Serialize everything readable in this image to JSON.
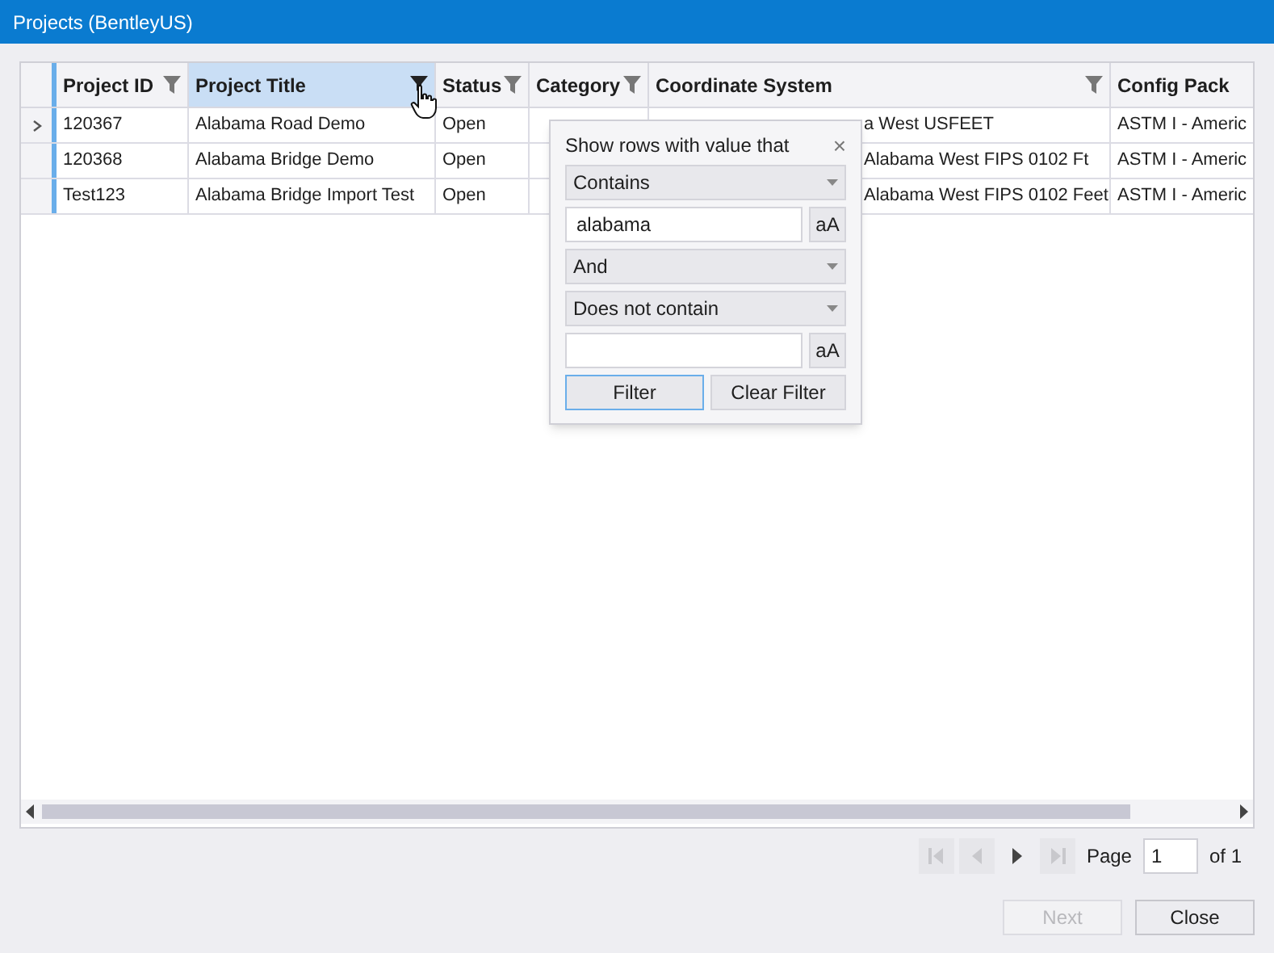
{
  "window": {
    "title": "Projects (BentleyUS)"
  },
  "table": {
    "columns": [
      {
        "label": "Project ID",
        "filterable": true,
        "selected": false
      },
      {
        "label": "Project Title",
        "filterable": true,
        "selected": true
      },
      {
        "label": "Status",
        "filterable": true,
        "selected": false
      },
      {
        "label": "Category",
        "filterable": true,
        "selected": false
      },
      {
        "label": "Coordinate System",
        "filterable": true,
        "selected": false
      },
      {
        "label": "Config Pack",
        "filterable": false,
        "selected": false
      }
    ],
    "rows": [
      {
        "current": true,
        "cells": [
          "120367",
          "Alabama Road Demo",
          "Open",
          "",
          "a West USFEET",
          "ASTM I - Americ"
        ]
      },
      {
        "current": false,
        "cells": [
          "120368",
          "Alabama Bridge Demo",
          "Open",
          "",
          "Alabama West FIPS 0102 Ft",
          "ASTM I - Americ"
        ]
      },
      {
        "current": false,
        "cells": [
          "Test123",
          "Alabama Bridge Import Test",
          "Open",
          "",
          "Alabama West FIPS 0102 Feet",
          "ASTM I - Americ"
        ]
      }
    ]
  },
  "filter_popup": {
    "title": "Show rows with value that",
    "close": "×",
    "operator_1": "Contains",
    "value_1": "alabama",
    "case_1": "aA",
    "logic": "And",
    "operator_2": "Does not contain",
    "case_2": "aA",
    "filter_button": "Filter",
    "clear_button": "Clear Filter"
  },
  "pager": {
    "buttons": [
      {
        "kind": "first",
        "disabled": true
      },
      {
        "kind": "prev",
        "disabled": true
      },
      {
        "kind": "next",
        "disabled": false
      },
      {
        "kind": "last",
        "disabled": true
      }
    ],
    "page_label": "Page",
    "page": "1",
    "of_label": "of 1"
  },
  "buttons": [
    {
      "label": "Next",
      "disabled": true
    },
    {
      "label": "Close",
      "disabled": false
    }
  ]
}
